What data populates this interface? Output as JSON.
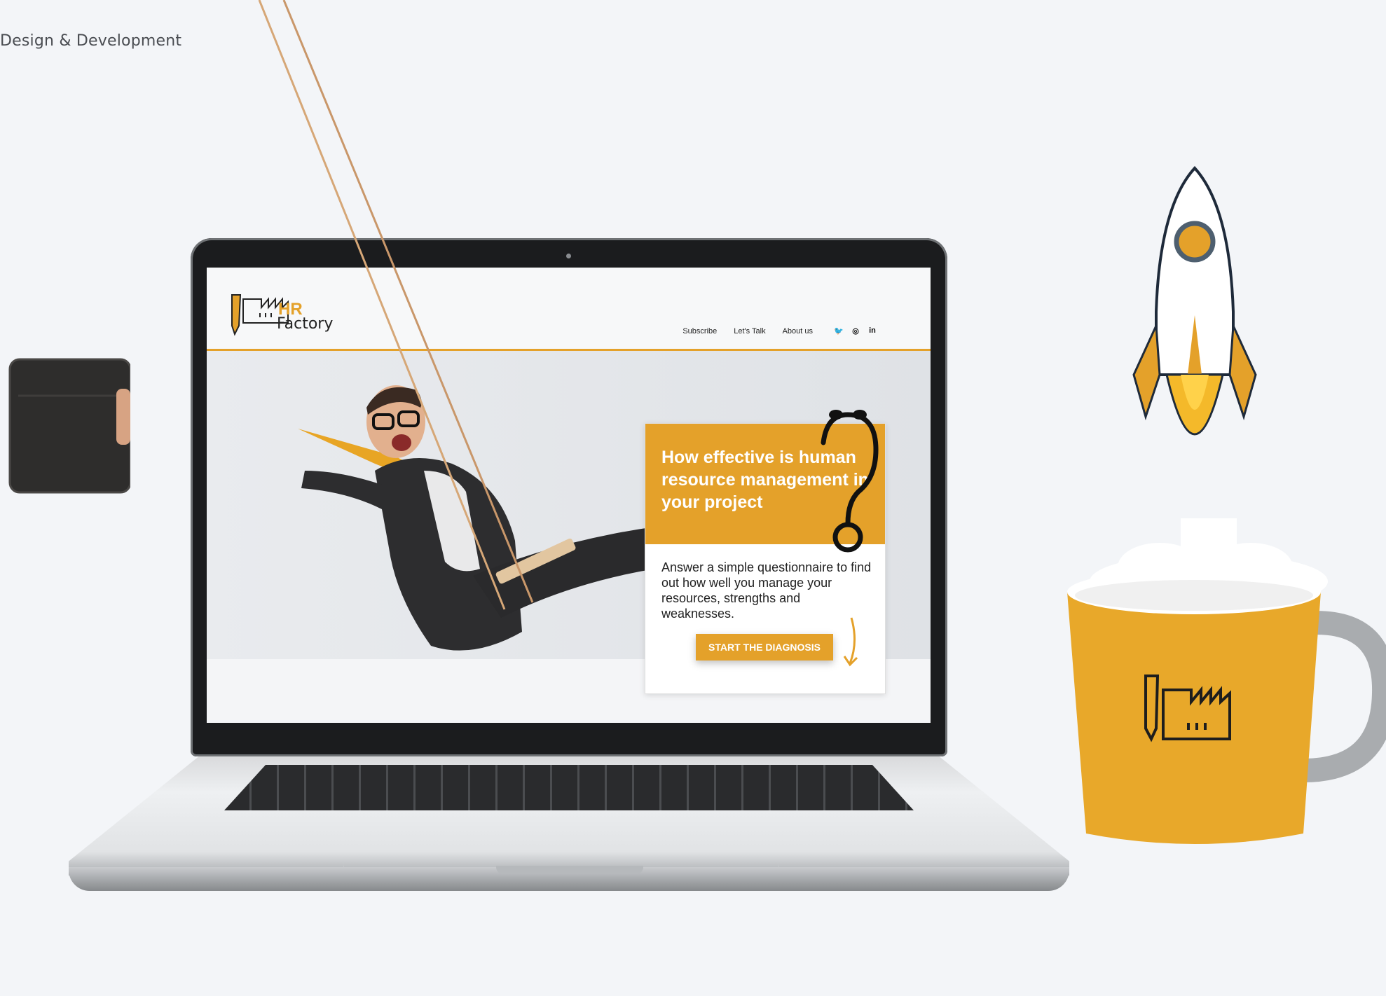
{
  "caption": "Design & Development",
  "website": {
    "logo": {
      "line1": "HR",
      "line2": "Factory"
    },
    "nav": {
      "items": [
        "Subscribe",
        "Let's Talk",
        "About us"
      ],
      "social_icons": [
        "twitter-icon",
        "instagram-icon",
        "linkedin-icon"
      ],
      "social_glyphs": [
        "🐦",
        "◎",
        "in"
      ]
    },
    "hero": {
      "title": "How effective is human resource management in your project",
      "description": "Answer a simple questionnaire to find out how well you manage your resources, strengths and weaknesses.",
      "cta_label": "START THE DIAGNOSIS"
    }
  },
  "colors": {
    "accent": "#e4a12a",
    "background": "#f3f5f8",
    "laptop_bezel": "#1b1c1e"
  }
}
